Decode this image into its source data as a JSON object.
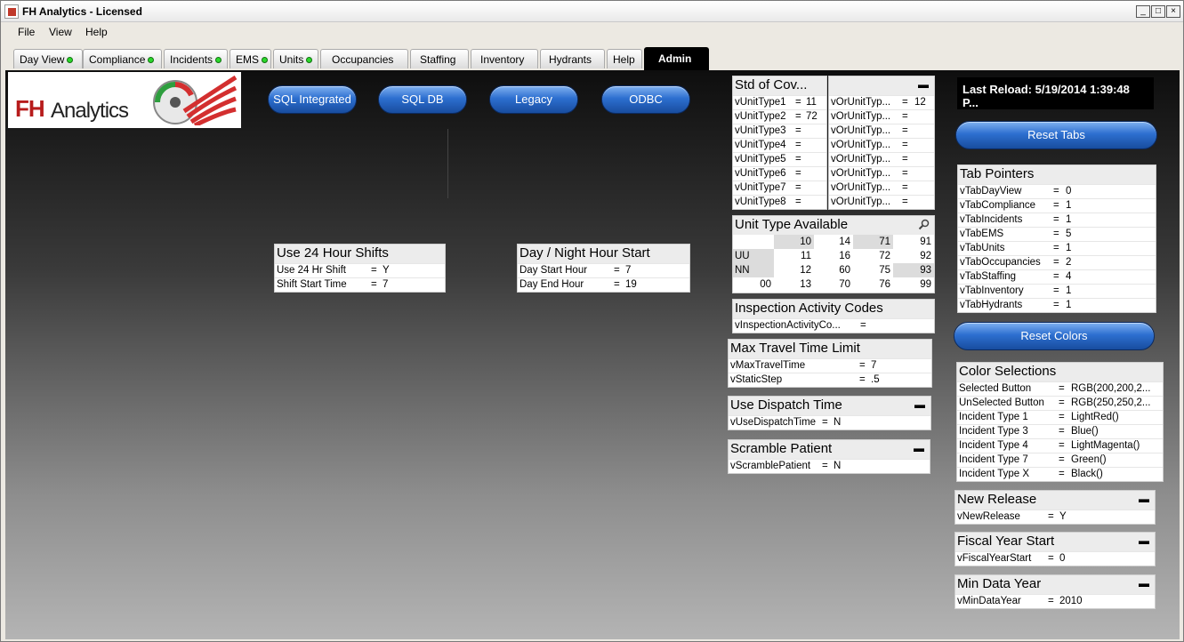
{
  "window": {
    "title": "FH Analytics - Licensed",
    "min": "_",
    "max": "□",
    "close": "×"
  },
  "menu": [
    "File",
    "View",
    "Help"
  ],
  "tabs": [
    {
      "label": "Day View",
      "dot": true
    },
    {
      "label": "Compliance",
      "dot": true
    },
    {
      "label": "Incidents",
      "dot": true
    },
    {
      "label": "EMS",
      "dot": true
    },
    {
      "label": "Units",
      "dot": true
    },
    {
      "label": "Occupancies",
      "dot": false
    },
    {
      "label": "Staffing",
      "dot": false
    },
    {
      "label": "Inventory",
      "dot": false
    },
    {
      "label": "Hydrants",
      "dot": false
    },
    {
      "label": "Help",
      "dot": false
    },
    {
      "label": "Admin",
      "dot": false,
      "active": true
    }
  ],
  "logo": {
    "fh": "FH",
    "analytics": "Analytics"
  },
  "buttons": {
    "sql_integrated": "SQL Integrated",
    "sql_db": "SQL DB",
    "legacy": "Legacy",
    "odbc": "ODBC",
    "reset_tabs": "Reset Tabs",
    "reset_colors": "Reset Colors"
  },
  "last_reload": "Last Reload: 5/19/2014 1:39:48 P...",
  "shifts": {
    "title": "Use 24 Hour Shifts",
    "rows": [
      [
        "Use 24 Hr Shift",
        "=",
        "Y"
      ],
      [
        "Shift Start Time",
        "=",
        "7"
      ]
    ]
  },
  "daynight": {
    "title": "Day / Night Hour Start",
    "rows": [
      [
        "Day Start Hour",
        "=",
        "7"
      ],
      [
        "Day End Hour",
        "=",
        "19"
      ]
    ]
  },
  "stdcov": {
    "title": "Std of Cov...",
    "left": [
      [
        "vUnitType1",
        "=",
        "11"
      ],
      [
        "vUnitType2",
        "=",
        "72"
      ],
      [
        "vUnitType3",
        "=",
        ""
      ],
      [
        "vUnitType4",
        "=",
        ""
      ],
      [
        "vUnitType5",
        "=",
        ""
      ],
      [
        "vUnitType6",
        "=",
        ""
      ],
      [
        "vUnitType7",
        "=",
        ""
      ],
      [
        "vUnitType8",
        "=",
        ""
      ]
    ],
    "right": [
      [
        "vOrUnitTyp...",
        "=",
        "12"
      ],
      [
        "vOrUnitTyp...",
        "=",
        ""
      ],
      [
        "vOrUnitTyp...",
        "=",
        ""
      ],
      [
        "vOrUnitTyp...",
        "=",
        ""
      ],
      [
        "vOrUnitTyp...",
        "=",
        ""
      ],
      [
        "vOrUnitTyp...",
        "=",
        ""
      ],
      [
        "vOrUnitTyp...",
        "=",
        ""
      ],
      [
        "vOrUnitTyp...",
        "=",
        ""
      ]
    ],
    "min": "▬"
  },
  "unittype": {
    "title": "Unit Type Available",
    "grid": [
      [
        "",
        "10",
        "14",
        "71",
        "91"
      ],
      [
        "UU",
        "11",
        "16",
        "72",
        "92"
      ],
      [
        "NN",
        "12",
        "60",
        "75",
        "93"
      ],
      [
        "00",
        "13",
        "70",
        "76",
        "99"
      ]
    ]
  },
  "inspection": {
    "title": "Inspection Activity Codes",
    "rows": [
      [
        "vInspectionActivityCo...",
        "=",
        ""
      ]
    ]
  },
  "maxtravel": {
    "title": "Max Travel Time Limit",
    "rows": [
      [
        "vMaxTravelTime",
        "=",
        "7"
      ],
      [
        "vStaticStep",
        "=",
        ".5"
      ]
    ]
  },
  "dispatch": {
    "title": "Use Dispatch Time",
    "rows": [
      [
        "vUseDispatchTime",
        "=",
        "N"
      ]
    ],
    "min": "▬"
  },
  "scramble": {
    "title": "Scramble Patient",
    "rows": [
      [
        "vScramblePatient",
        "=",
        "N"
      ]
    ],
    "min": "▬"
  },
  "tabpointers": {
    "title": "Tab Pointers",
    "rows": [
      [
        "vTabDayView",
        "=",
        "0"
      ],
      [
        "vTabCompliance",
        "=",
        "1"
      ],
      [
        "vTabIncidents",
        "=",
        "1"
      ],
      [
        "vTabEMS",
        "=",
        "5"
      ],
      [
        "vTabUnits",
        "=",
        "1"
      ],
      [
        "vTabOccupancies",
        "=",
        "2"
      ],
      [
        "vTabStaffing",
        "=",
        "4"
      ],
      [
        "vTabInventory",
        "=",
        "1"
      ],
      [
        "vTabHydrants",
        "=",
        "1"
      ]
    ]
  },
  "colors": {
    "title": "Color Selections",
    "rows": [
      [
        "Selected Button",
        "=",
        "RGB(200,200,2..."
      ],
      [
        "UnSelected Button",
        "=",
        "RGB(250,250,2..."
      ],
      [
        "Incident Type 1",
        "=",
        "LightRed()"
      ],
      [
        "Incident Type 3",
        "=",
        "Blue()"
      ],
      [
        "Incident Type 4",
        "=",
        "LightMagenta()"
      ],
      [
        "Incident Type 7",
        "=",
        "Green()"
      ],
      [
        "Incident Type X",
        "=",
        "Black()"
      ]
    ]
  },
  "newrelease": {
    "title": "New Release",
    "rows": [
      [
        "vNewRelease",
        "=",
        "Y"
      ]
    ],
    "min": "▬"
  },
  "fiscal": {
    "title": "Fiscal Year Start",
    "rows": [
      [
        "vFiscalYearStart",
        "=",
        "0"
      ]
    ],
    "min": "▬"
  },
  "mindata": {
    "title": "Min Data Year",
    "rows": [
      [
        "vMinDataYear",
        "=",
        "2010"
      ]
    ],
    "min": "▬"
  },
  "icons": {
    "app": "app-icon",
    "search": "search-icon"
  },
  "colors_ui": {
    "pill_blue": "#2d6fd0",
    "tab_active": "#000000",
    "status_dot": "#2bd82b"
  }
}
